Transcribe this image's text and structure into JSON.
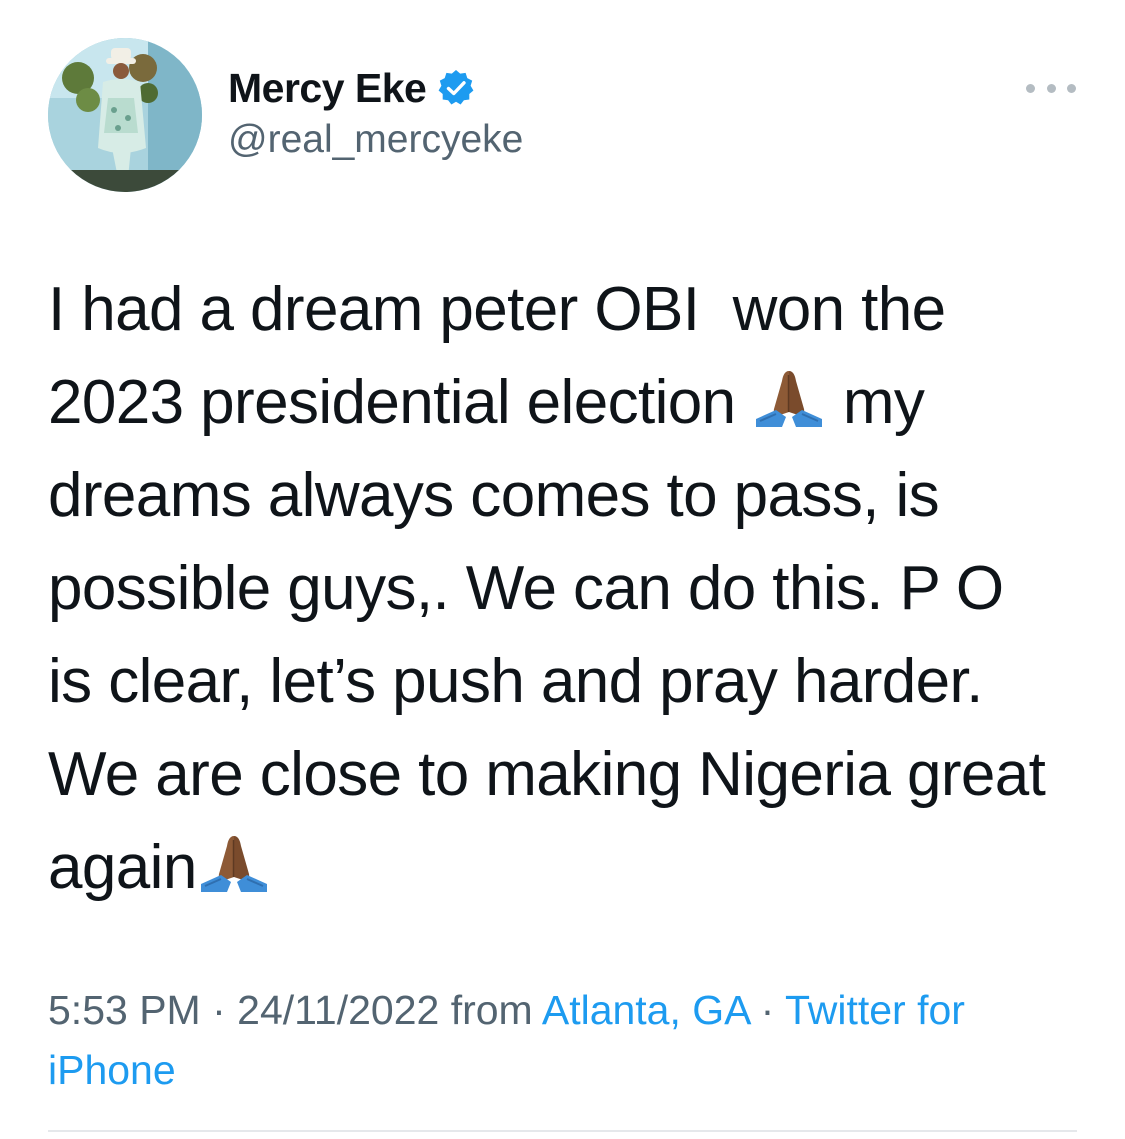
{
  "author": {
    "display_name": "Mercy Eke",
    "handle": "@real_mercyeke",
    "verified": true,
    "avatar_icon": "profile-photo"
  },
  "more_icon": "more-options-icon",
  "tweet": {
    "lines": [
      "I had a dream peter OBI  won the",
      "2023 presidential election",
      "my",
      "dreams always comes to pass, is",
      "possible guys,. We can do this. P O",
      "is clear, let’s push and pray harder.",
      "We are close to making Nigeria great",
      "again"
    ],
    "emoji": "folded-hands-icon"
  },
  "meta": {
    "time": "5:53 PM",
    "sep1": " · ",
    "date": "24/11/2022",
    "from_text": " from ",
    "location": "Atlanta, GA",
    "sep2": " · ",
    "source": "Twitter for iPhone"
  },
  "colors": {
    "accent": "#1d9bf0",
    "text": "#0f1419",
    "secondary": "#536471"
  }
}
